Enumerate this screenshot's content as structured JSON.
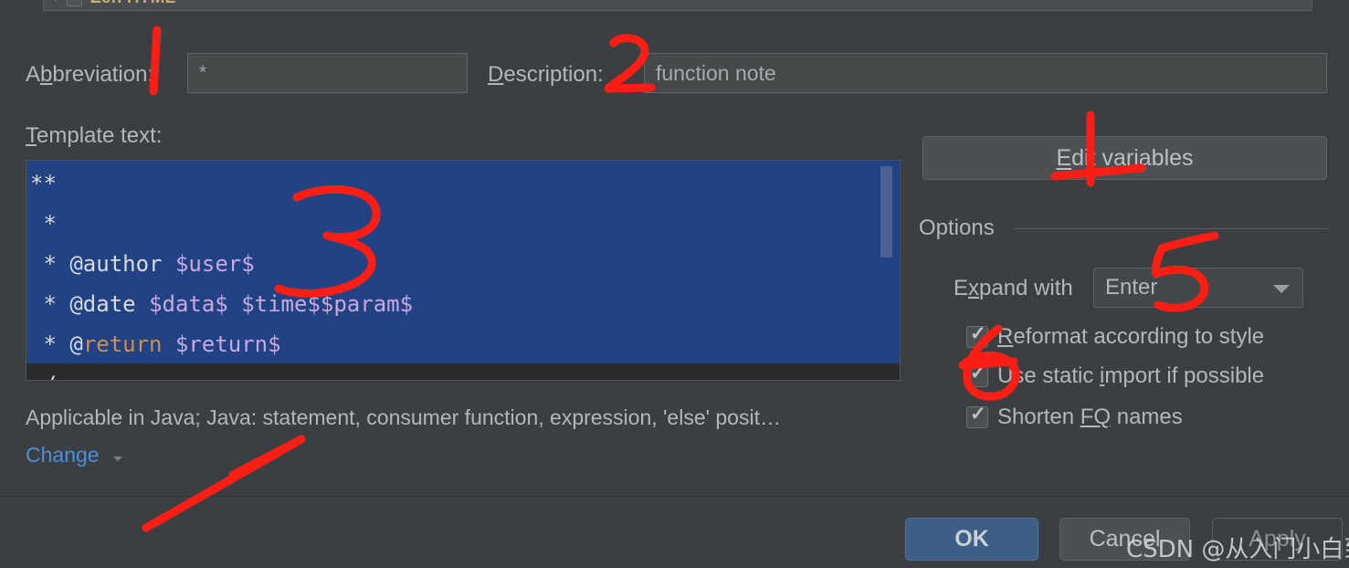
{
  "tree": {
    "item_label": "Zen HTML",
    "expanded": true,
    "checked": true
  },
  "fields": {
    "abbreviation_label": "Abbreviation:",
    "abbreviation_mnemonic": "b",
    "abbreviation_value": "*",
    "description_label": "Description:",
    "description_mnemonic": "D",
    "description_value": "function note",
    "template_text_label": "Template text:",
    "template_text_mnemonic": "T"
  },
  "editor": {
    "lines": [
      [
        {
          "t": "**",
          "c": "c-cmt"
        }
      ],
      [
        {
          "t": " *",
          "c": "c-cmt"
        }
      ],
      [
        {
          "t": " * ",
          "c": "c-cmt"
        },
        {
          "t": "@author",
          "c": "c-cmt"
        },
        {
          "t": " ",
          "c": "c-plain"
        },
        {
          "t": "$user$",
          "c": "c-var"
        }
      ],
      [
        {
          "t": " * ",
          "c": "c-cmt"
        },
        {
          "t": "@date",
          "c": "c-cmt"
        },
        {
          "t": " ",
          "c": "c-plain"
        },
        {
          "t": "$data$ $time$$param$",
          "c": "c-var"
        }
      ],
      [
        {
          "t": " * ",
          "c": "c-cmt"
        },
        {
          "t": "@",
          "c": "c-cmt"
        },
        {
          "t": "return",
          "c": "c-tag"
        },
        {
          "t": " ",
          "c": "c-plain"
        },
        {
          "t": "$return$",
          "c": "c-var"
        }
      ],
      [
        {
          "t": " /",
          "c": "c-cmt"
        }
      ]
    ],
    "selection_color": "#214283",
    "background": "#2b2b2b"
  },
  "context": {
    "applicable_text": "Applicable in Java; Java: statement, consumer function, expression, 'else' posit…",
    "change_link": "Change"
  },
  "options": {
    "edit_variables_label": "Edit variables",
    "edit_variables_mnemonic": "E",
    "section_title": "Options",
    "expand_with_label": "Expand with",
    "expand_with_mnemonic": "x",
    "expand_with_value": "Enter",
    "checkboxes": [
      {
        "label": "Reformat according to style",
        "mnemonic": "R",
        "checked": true
      },
      {
        "label": "Use static import if possible",
        "mnemonic": "i",
        "checked": true
      },
      {
        "label": "Shorten FQ names",
        "mnemonic": "FQ",
        "checked": true
      }
    ]
  },
  "footer": {
    "ok_label": "OK",
    "cancel_label": "Cancel",
    "apply_label": "Apply"
  },
  "watermark": {
    "text": "CSDN @从入门小白到小黑"
  },
  "annotations": {
    "color": "#fa1e14",
    "marks": [
      "1",
      "2",
      "3",
      "4",
      "5",
      "6",
      "arrow"
    ]
  },
  "colors": {
    "window_bg": "#3c3f41",
    "field_bg": "#45494a",
    "accent_blue": "#3d5f87",
    "link_blue": "#4a8ede",
    "annotation_red": "#fa1e14",
    "tree_label": "#c8ab7d"
  }
}
